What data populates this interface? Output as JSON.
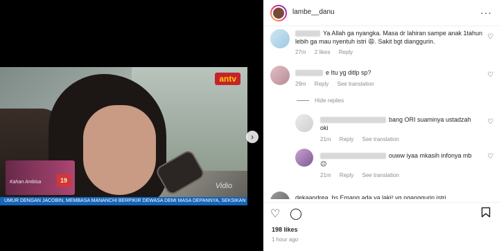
{
  "video": {
    "channel_logo": "antv",
    "watermark": "Vidio",
    "promo_badge": "19",
    "promo_caption": "Kahan Ambisa",
    "ticker": "UMUR DENGAN JACOBIN, MEMBASA MANANCHI BERPIKIR DEWASA DEMI MASA DEPANNYA, SEKSIKAN"
  },
  "post": {
    "username": "lambe__danu",
    "more_icon": "more-icon",
    "likes": "198 likes",
    "time": "1 hour ago"
  },
  "comments": [
    {
      "text": "Ya Allah ga nyangka. Masa dr lahiran sampe anak 1tahun lebih ga mau nyentuh istri 😩. Sakit bgt dianggurin.",
      "time": "27m",
      "likes": "2 likes",
      "reply": "Reply"
    },
    {
      "text": "e Itu yg ditlp sp?",
      "time": "29m",
      "reply": "Reply",
      "translate": "See translation",
      "hide_replies": "Hide replies"
    },
    {
      "text": "bang ORI suaminya ustadzah oki",
      "time": "21m",
      "reply": "Reply",
      "translate": "See translation"
    },
    {
      "text": "ouww iyaa mkasih infonya mb 😉",
      "time": "21m",
      "reply": "Reply",
      "translate": "See translation"
    },
    {
      "text": "dekaandrea_hs Emang ada ya laki² yg nganggurin istri"
    }
  ],
  "icons": {
    "heart": "heart-icon",
    "comment": "comment-icon",
    "bookmark": "bookmark-icon",
    "next": "chevron-right-icon"
  },
  "colors": {
    "brand_gradient_start": "#f9ce34",
    "brand_gradient_end": "#6228d7",
    "muted_text": "#8e8e8e"
  }
}
